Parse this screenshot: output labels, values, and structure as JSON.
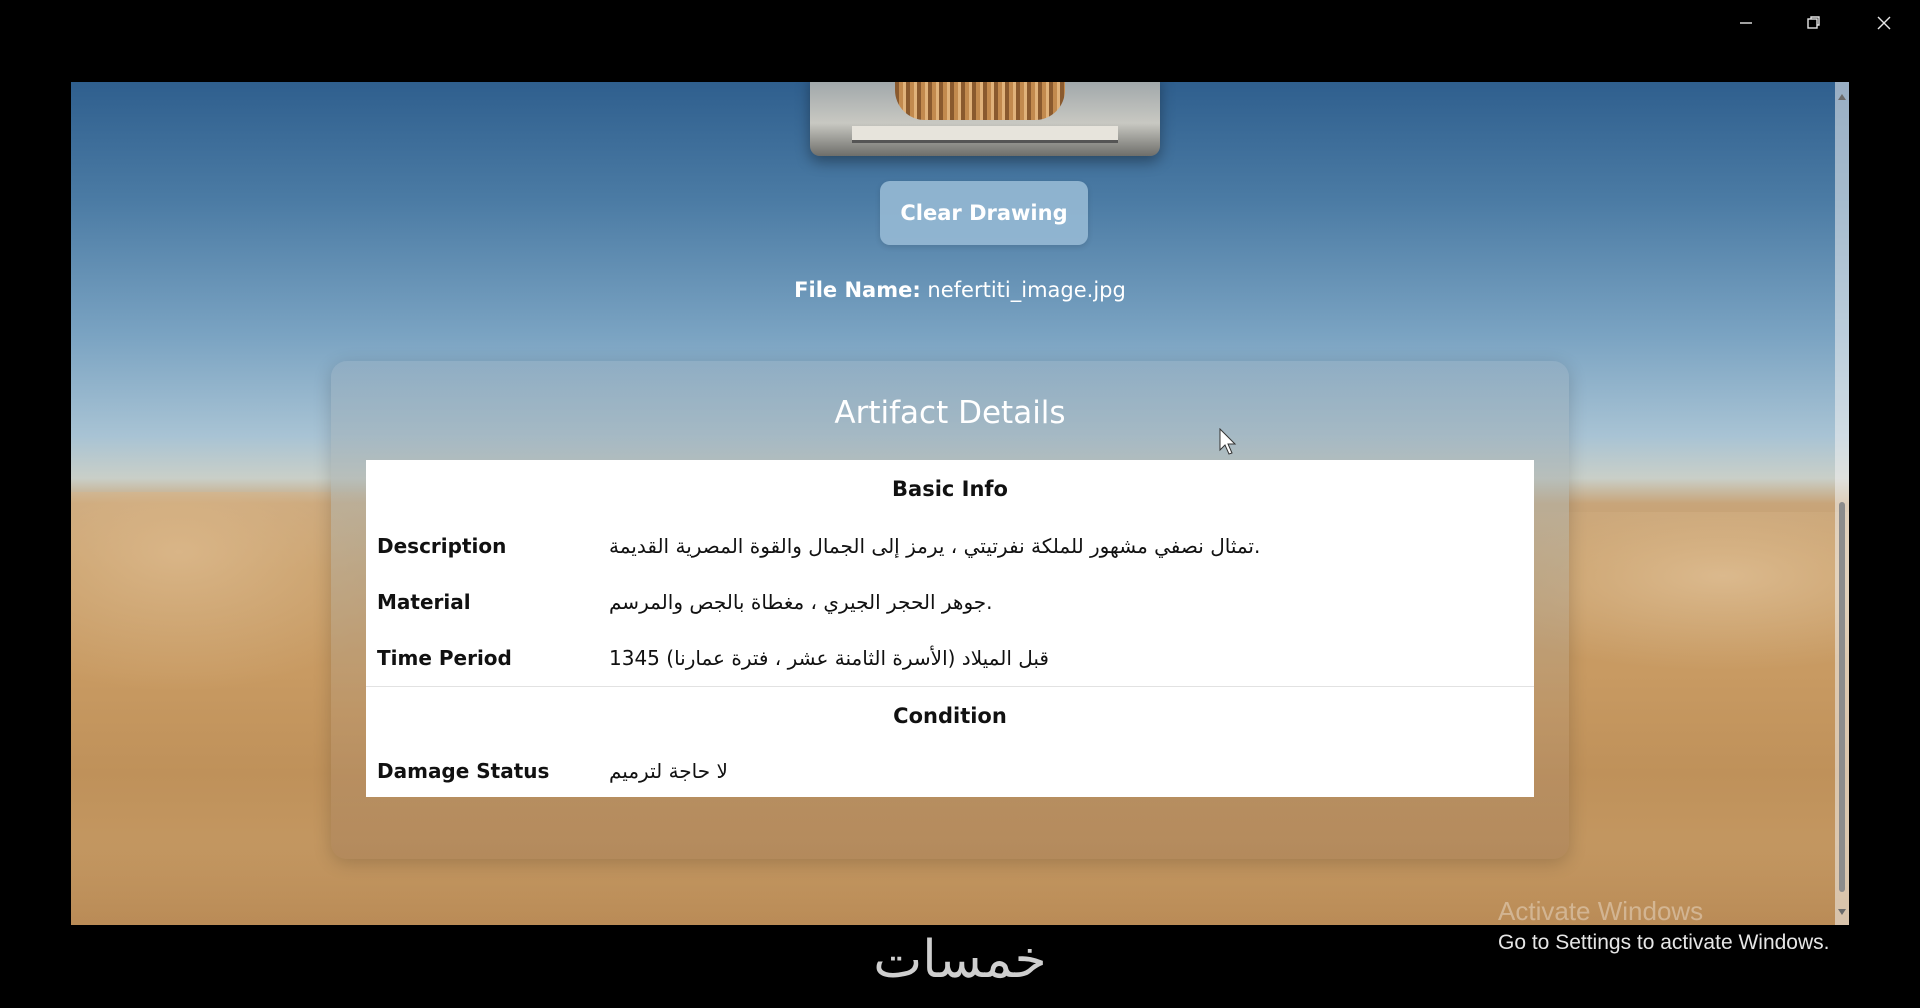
{
  "window_controls": {
    "minimize_icon": "minimize-icon",
    "restore_icon": "restore-icon",
    "close_icon": "close-icon"
  },
  "toolbar": {
    "clear_label": "Clear Drawing"
  },
  "file": {
    "label": "File Name:",
    "value": "nefertiti_image.jpg"
  },
  "details": {
    "title": "Artifact Details",
    "sections": [
      {
        "heading": "Basic Info",
        "rows": [
          {
            "label": "Description",
            "value": "تمثال نصفي مشهور للملكة نفرتيتي ، يرمز إلى الجمال والقوة المصرية القديمة."
          },
          {
            "label": "Material",
            "value": "جوهر الحجر الجيري ، مغطاة بالجص والمرسم."
          },
          {
            "label": "Time Period",
            "value": "1345 قبل الميلاد (الأسرة الثامنة عشر ، فترة عمارنا)"
          }
        ]
      },
      {
        "heading": "Condition",
        "rows": [
          {
            "label": "Damage Status",
            "value": "لا حاجة لترميم"
          }
        ]
      }
    ]
  },
  "os_notice": {
    "title": "Activate Windows",
    "subtitle": "Go to Settings to activate Windows."
  },
  "watermark": {
    "text": "خمسات"
  },
  "colors": {
    "button_bg": "#96b9d4",
    "table_bg": "#ffffff",
    "title_text": "#ffffff"
  }
}
